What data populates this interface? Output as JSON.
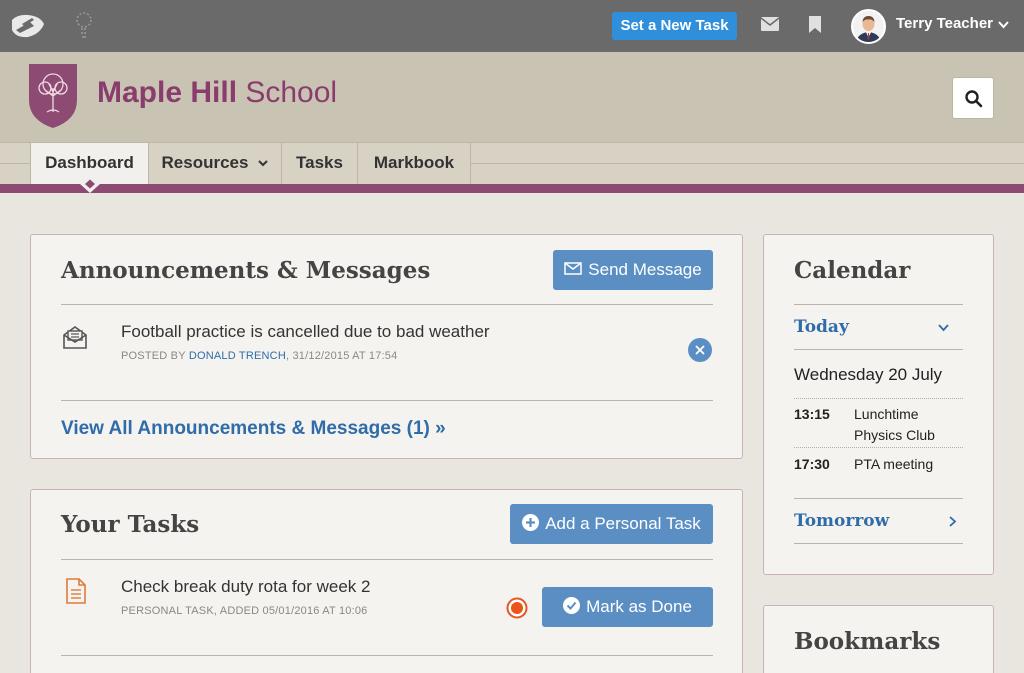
{
  "topbar": {
    "new_task_label": "Set a New Task",
    "user_name": "Terry Teacher"
  },
  "school": {
    "name_bold": "Maple Hill",
    "name_regular": " School"
  },
  "nav": {
    "tabs": [
      "Dashboard",
      "Resources",
      "Tasks",
      "Markbook"
    ]
  },
  "announcements": {
    "title": "Announcements & Messages",
    "send_label": "Send Message",
    "items": [
      {
        "title": "Football practice is cancelled due to bad weather",
        "meta_prefix": "Posted by ",
        "author": "Donald Trench",
        "meta_suffix": ", 31/12/2015 at 17:54"
      }
    ],
    "view_all": "View All Announcements & Messages (1) »"
  },
  "tasks": {
    "title": "Your Tasks",
    "add_label": "Add a Personal Task",
    "items": [
      {
        "title": "Check break duty rota for week 2",
        "meta": "Personal Task, added 05/01/2016 at 10:06",
        "done_label": "Mark as Done"
      }
    ]
  },
  "calendar": {
    "title": "Calendar",
    "today_label": "Today",
    "date": "Wednesday 20 July",
    "events": [
      {
        "time": "13:15",
        "name": "Lunchtime Physics Club"
      },
      {
        "time": "17:30",
        "name": "PTA meeting"
      }
    ],
    "tomorrow_label": "Tomorrow"
  },
  "bookmarks": {
    "title": "Bookmarks"
  },
  "colors": {
    "brand_purple": "#8d4a72",
    "action_blue": "#5b8fc4",
    "primary_blue": "#2f8fdb",
    "link_blue": "#2f6ca8"
  }
}
